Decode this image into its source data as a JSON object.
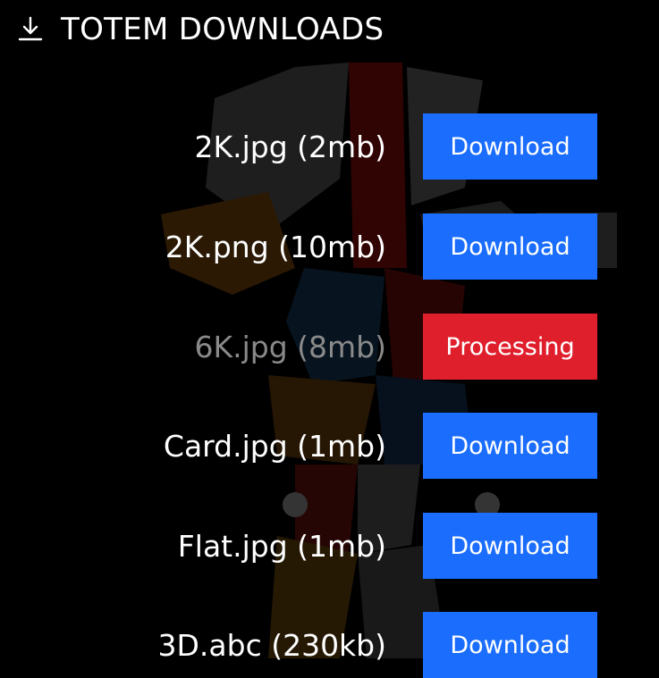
{
  "header": {
    "title": "TOTEM DOWNLOADS",
    "icon": "download-icon"
  },
  "files": [
    {
      "name": "2K.jpg (2mb)",
      "action": "Download",
      "state": "ready"
    },
    {
      "name": "2K.png (10mb)",
      "action": "Download",
      "state": "ready"
    },
    {
      "name": "6K.jpg (8mb)",
      "action": "Processing",
      "state": "processing"
    },
    {
      "name": "Card.jpg (1mb)",
      "action": "Download",
      "state": "ready"
    },
    {
      "name": "Flat.jpg (1mb)",
      "action": "Download",
      "state": "ready"
    },
    {
      "name": "3D.abc (230kb)",
      "action": "Download",
      "state": "ready"
    }
  ],
  "colors": {
    "background": "#000000",
    "download_button": "#1a6dfd",
    "processing_button": "#e01f2d",
    "text": "#ffffff",
    "dim_text": "#8a8a8a"
  }
}
